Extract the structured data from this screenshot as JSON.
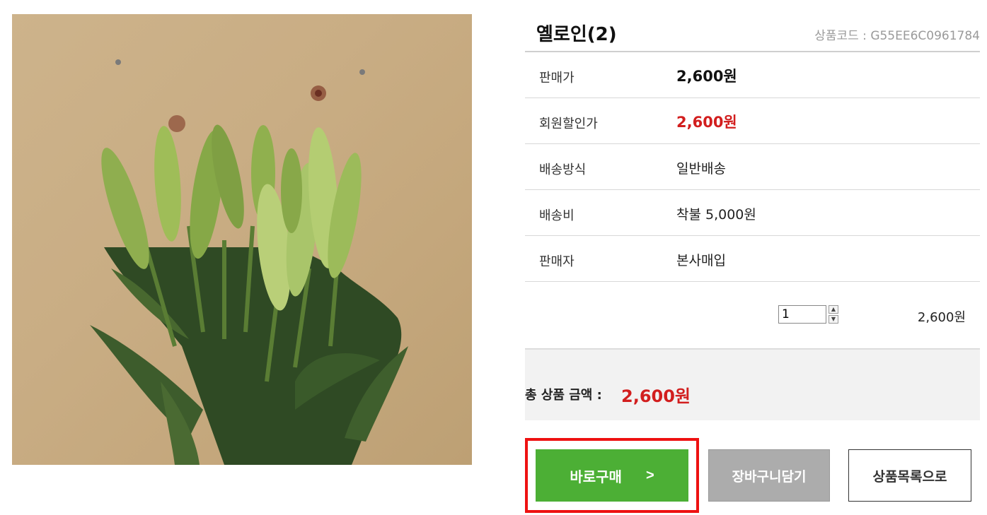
{
  "product": {
    "title": "옐로인(2)",
    "code_text": "상품코드 : G55EE6C0961784",
    "image_icon": "lily-buds-photo"
  },
  "details": [
    {
      "label": "판매가",
      "value": "2,600원"
    },
    {
      "label": "회원할인가",
      "value": "2,600원"
    },
    {
      "label": "배송방식",
      "value": "일반배송"
    },
    {
      "label": "배송비",
      "value": "착불 5,000원"
    },
    {
      "label": "판매자",
      "value": "본사매입"
    }
  ],
  "quantity": {
    "value": "1",
    "line_total": "2,600원"
  },
  "total": {
    "label": "총 상품 금액 :",
    "amount": "2,600원"
  },
  "actions": {
    "buy_now": "바로구매",
    "buy_arrow": ">",
    "add_cart": "장바구니담기",
    "to_list": "상품목록으로"
  },
  "colors": {
    "sale_price": "#d21e1e",
    "buy_button": "#4caf35",
    "cart_button": "#acacac",
    "highlight": "#ee1111"
  }
}
